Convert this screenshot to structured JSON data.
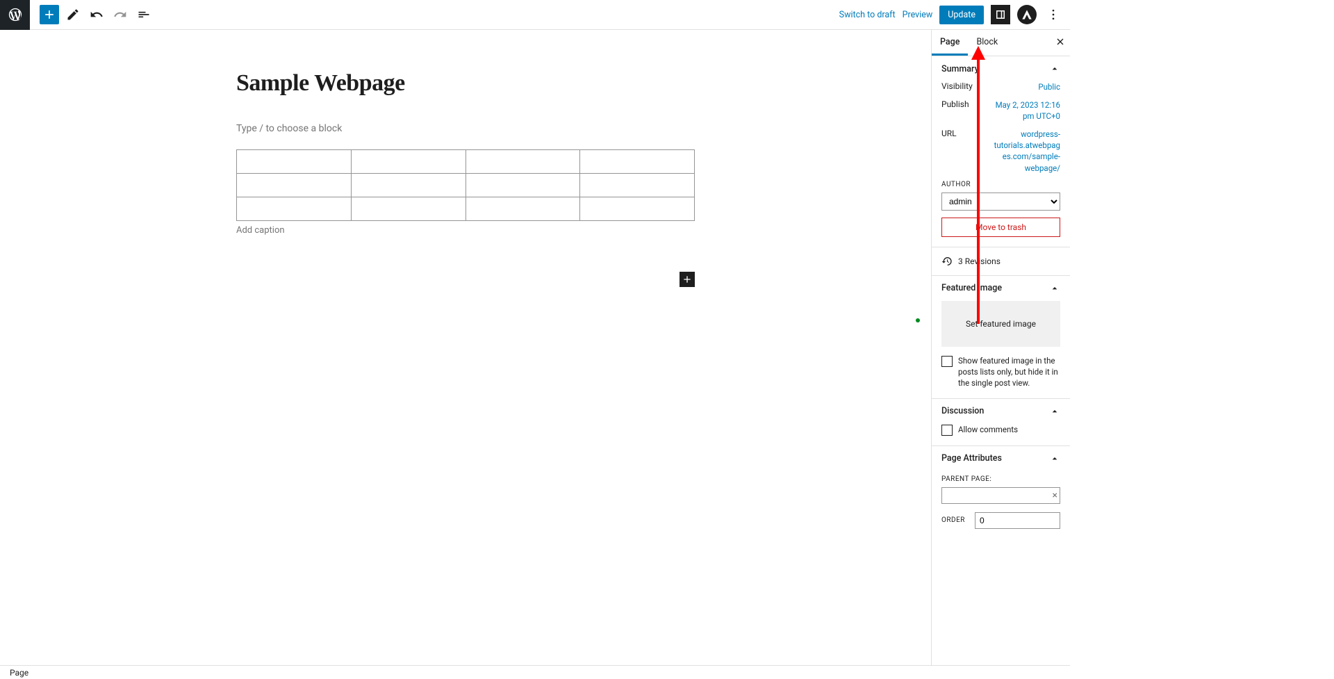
{
  "toolbar": {
    "switch_draft": "Switch to draft",
    "preview": "Preview",
    "update": "Update"
  },
  "editor": {
    "title": "Sample Webpage",
    "block_placeholder": "Type / to choose a block",
    "caption_placeholder": "Add caption",
    "table": {
      "rows": 3,
      "cols": 4
    }
  },
  "sidebar": {
    "tabs": {
      "page": "Page",
      "block": "Block"
    },
    "summary": {
      "header": "Summary",
      "visibility_label": "Visibility",
      "visibility_value": "Public",
      "publish_label": "Publish",
      "publish_value": "May 2, 2023 12:16 pm UTC+0",
      "url_label": "URL",
      "url_value": "wordpress-tutorials.atwebpages.com/sample-webpage/",
      "author_label": "AUTHOR",
      "author_value": "admin",
      "trash": "Move to trash",
      "revisions": "3 Revisions"
    },
    "featured": {
      "header": "Featured image",
      "set": "Set featured image",
      "checkbox_text": "Show featured image in the posts lists only, but hide it in the single post view."
    },
    "discussion": {
      "header": "Discussion",
      "allow": "Allow comments"
    },
    "attributes": {
      "header": "Page Attributes",
      "parent_label": "PARENT PAGE:",
      "order_label": "ORDER",
      "order_value": "0"
    }
  },
  "statusbar": {
    "breadcrumb": "Page"
  }
}
